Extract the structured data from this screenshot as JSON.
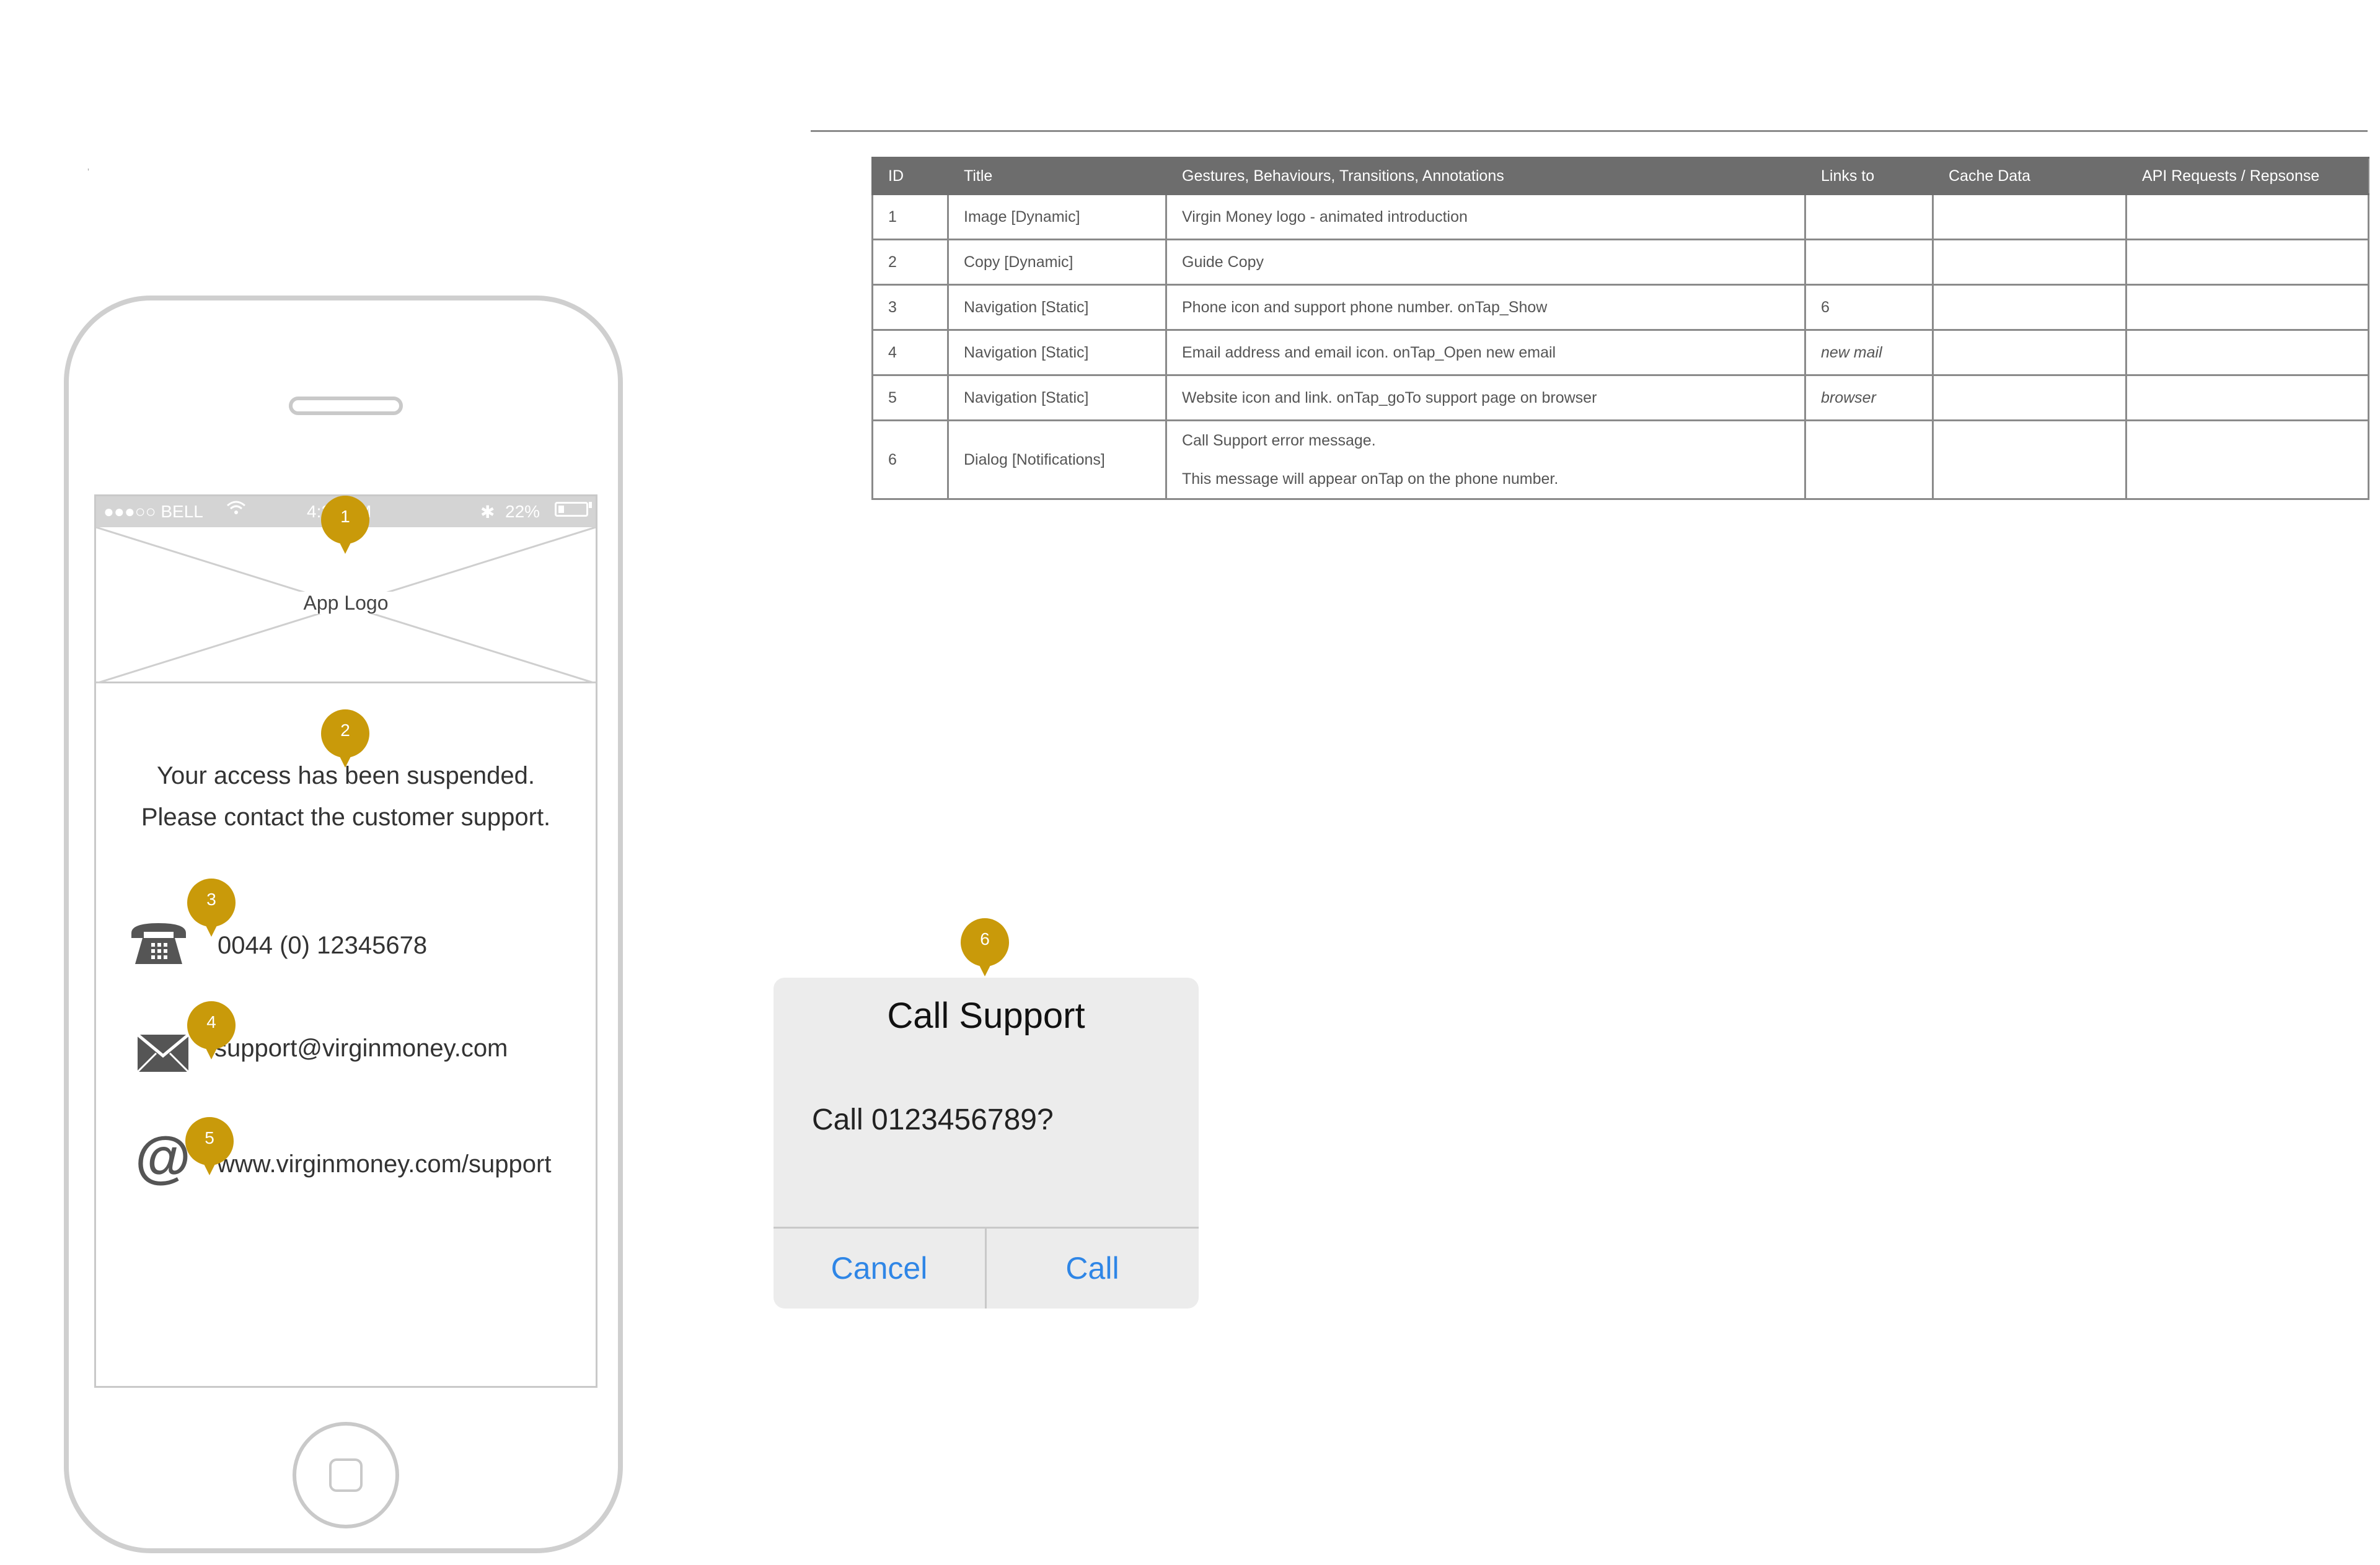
{
  "table": {
    "headers": [
      "ID",
      "Title",
      "Gestures, Behaviours, Transitions, Annotations",
      "Links to",
      "Cache Data",
      "API Requests / Repsonse"
    ],
    "rows": [
      {
        "id": "1",
        "title": "Image [Dynamic]",
        "notes": "Virgin Money logo - animated introduction",
        "links": "",
        "cache": "",
        "api": ""
      },
      {
        "id": "2",
        "title": "Copy [Dynamic]",
        "notes": "Guide Copy",
        "links": "",
        "cache": "",
        "api": ""
      },
      {
        "id": "3",
        "title": "Navigation [Static]",
        "notes": "Phone icon and support phone number. onTap_Show",
        "links": "6",
        "cache": "",
        "api": ""
      },
      {
        "id": "4",
        "title": "Navigation [Static]",
        "notes": "Email address and email icon. onTap_Open new email",
        "links": "new mail",
        "cache": "",
        "api": ""
      },
      {
        "id": "5",
        "title": "Navigation [Static]",
        "notes": "Website icon and link. onTap_goTo support page on browser",
        "links": "browser",
        "cache": "",
        "api": ""
      },
      {
        "id": "6",
        "title": "Dialog [Notifications]",
        "notes_line1": "Call Support error message.",
        "notes_line2": "This message will appear onTap on the phone number.",
        "links": "",
        "cache": "",
        "api": ""
      }
    ]
  },
  "phone": {
    "status_bar": {
      "signal": "●●●○○ BELL",
      "time": "4:21 PM",
      "bluetooth": "✱",
      "battery": "22%",
      "battery_level": 0.22
    },
    "logo_label": "App Logo",
    "guide_line_1": "Your access has been suspended.",
    "guide_line_2": "Please contact the customer support.",
    "phone_number": "0044 (0) 12345678",
    "email": "support@virginmoney.com",
    "website": "www.virginmoney.com/support",
    "icons": {
      "phone": "telephone-icon",
      "mail": "envelope-icon",
      "web": "at-sign-icon"
    }
  },
  "markers": [
    "1",
    "2",
    "3",
    "4",
    "5",
    "6"
  ],
  "dialog": {
    "title": "Call Support",
    "message": "Call 0123456789?",
    "cancel_label": "Cancel",
    "call_label": "Call"
  },
  "colors": {
    "marker": "#c99a0a",
    "table_header": "#6d6d6d",
    "dialog_bg": "#ececec",
    "dialog_action": "#2f86e6"
  },
  "stray_mark": "'"
}
